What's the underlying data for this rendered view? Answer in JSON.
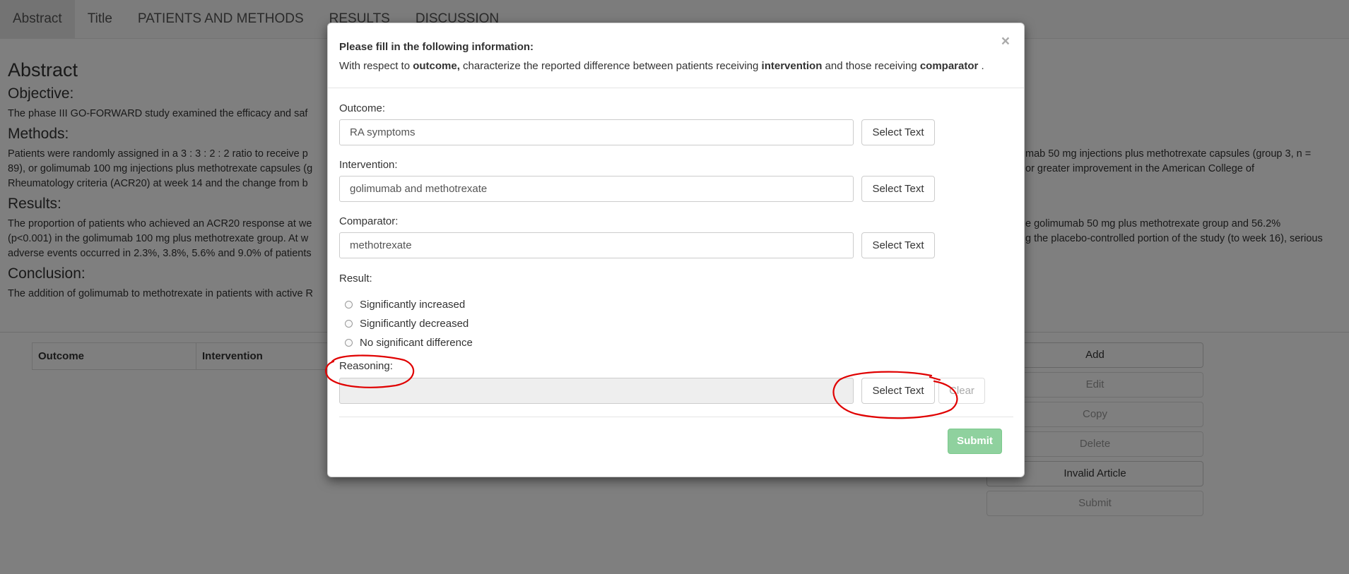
{
  "nav": {
    "tabs": [
      {
        "label": "Abstract",
        "active": true
      },
      {
        "label": "Title"
      },
      {
        "label": "PATIENTS AND METHODS"
      },
      {
        "label": "RESULTS"
      },
      {
        "label": "DISCUSSION"
      }
    ]
  },
  "article": {
    "heading": "Abstract",
    "objective_heading": "Objective:",
    "objective_text": "The phase III GO-FORWARD study examined the efficacy and saf",
    "methods_heading": "Methods:",
    "methods_text_1": "Patients were randomly assigned in a 3 : 3 : 2 : 2 ratio to receive p",
    "methods_text_1_right": "mab 50 mg injections plus methotrexate capsules (group 3, n =",
    "methods_text_2": "89), or golimumab 100 mg injections plus methotrexate capsules (g",
    "methods_text_2_right": "or greater improvement in the American College of",
    "methods_text_3": "Rheumatology criteria (ACR20) at week 14 and the change from b",
    "results_heading": "Results:",
    "results_text_1": "The proportion of patients who achieved an ACR20 response at we",
    "results_text_1_right": "e golimumab 50 mg plus methotrexate group and 56.2%",
    "results_text_2": "(p<0.001) in the golimumab 100 mg plus methotrexate group. At w",
    "results_text_2_right": "g the placebo-controlled portion of the study (to week 16), serious",
    "results_text_3": "adverse events occurred in 2.3%, 3.8%, 5.6% and 9.0% of patients",
    "conclusion_heading": "Conclusion:",
    "conclusion_text": "The addition of golimumab to methotrexate in patients with active R"
  },
  "table": {
    "headers": [
      "Outcome",
      "Intervention"
    ]
  },
  "side_buttons": [
    {
      "label": "Add",
      "enabled": true
    },
    {
      "label": "Edit",
      "enabled": false
    },
    {
      "label": "Copy",
      "enabled": false
    },
    {
      "label": "Delete",
      "enabled": false
    },
    {
      "label": "Invalid Article",
      "enabled": true
    },
    {
      "label": "Submit",
      "enabled": false
    }
  ],
  "modal": {
    "title": "Please fill in the following information:",
    "subtitle_parts": {
      "p1": "With respect to ",
      "outcome": "outcome,",
      "p2": " characterize the reported difference between patients receiving ",
      "intervention": "intervention",
      "p3": " and those receiving ",
      "comparator": "comparator",
      "p4": " ."
    },
    "close_symbol": "×",
    "outcome_label": "Outcome:",
    "outcome_value": "RA symptoms",
    "intervention_label": "Intervention:",
    "intervention_value": "golimumab and methotrexate",
    "comparator_label": "Comparator:",
    "comparator_value": "methotrexate",
    "select_text_label": "Select Text",
    "result_label": "Result:",
    "result_options": [
      "Significantly increased",
      "Significantly decreased",
      "No significant difference"
    ],
    "reasoning_label": "Reasoning:",
    "reasoning_value": "",
    "clear_label": "Clear",
    "submit_label": "Submit"
  },
  "colors": {
    "annotation_red": "#e00000",
    "submit_green": "#8fd19e"
  }
}
